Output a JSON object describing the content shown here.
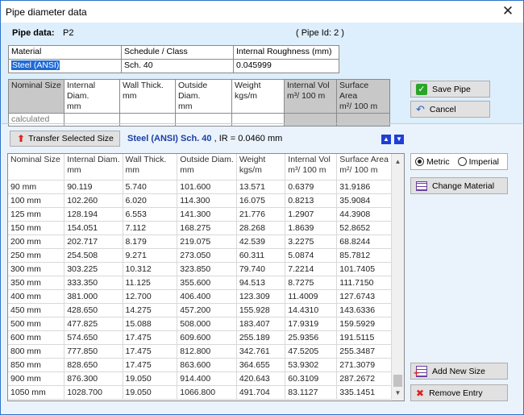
{
  "window": {
    "title": "Pipe diameter data",
    "close_icon": "close-icon"
  },
  "pipe_data": {
    "label": "Pipe data:",
    "value": "P2",
    "pipe_id": "( Pipe Id: 2 )"
  },
  "material_table": {
    "headers": [
      "Material",
      "Schedule / Class",
      "Internal Roughness (mm)"
    ],
    "values": [
      "Steel (ANSI)",
      "Sch.  40",
      "0.045999"
    ]
  },
  "size_table": {
    "headers": [
      [
        "Nominal Size",
        ""
      ],
      [
        "Internal Diam.",
        "mm"
      ],
      [
        "Wall Thick.",
        "mm"
      ],
      [
        "Outside Diam.",
        "mm"
      ],
      [
        "Weight",
        "kgs/m"
      ],
      [
        "Internal Vol",
        "m³/ 100 m"
      ],
      [
        "Surface Area",
        "m²/ 100 m"
      ]
    ],
    "row": [
      "calculated",
      "",
      "",
      "",
      "",
      "",
      ""
    ]
  },
  "buttons": {
    "save": "Save Pipe",
    "cancel": "Cancel",
    "transfer": "Transfer Selected Size",
    "change_material": "Change Material",
    "add_size": "Add New Size",
    "remove": "Remove Entry"
  },
  "transfer_info": {
    "material": "Steel (ANSI) Sch.  40",
    "ir": ", IR = 0.0460 mm"
  },
  "units": {
    "metric": "Metric",
    "imperial": "Imperial",
    "selected": "metric"
  },
  "list": {
    "headers": [
      [
        "Nominal Size",
        ""
      ],
      [
        "Internal Diam.",
        "mm"
      ],
      [
        "Wall Thick.",
        "mm"
      ],
      [
        "Outside Diam.",
        "mm"
      ],
      [
        "Weight",
        "kgs/m"
      ],
      [
        "Internal Vol",
        "m³/ 100 m"
      ],
      [
        "Surface Area",
        "m²/ 100 m"
      ]
    ],
    "rows": [
      [
        "90 mm",
        "90.119",
        "5.740",
        "101.600",
        "13.571",
        "0.6379",
        "31.9186"
      ],
      [
        "100 mm",
        "102.260",
        "6.020",
        "114.300",
        "16.075",
        "0.8213",
        "35.9084"
      ],
      [
        "125 mm",
        "128.194",
        "6.553",
        "141.300",
        "21.776",
        "1.2907",
        "44.3908"
      ],
      [
        "150 mm",
        "154.051",
        "7.112",
        "168.275",
        "28.268",
        "1.8639",
        "52.8652"
      ],
      [
        "200 mm",
        "202.717",
        "8.179",
        "219.075",
        "42.539",
        "3.2275",
        "68.8244"
      ],
      [
        "250 mm",
        "254.508",
        "9.271",
        "273.050",
        "60.311",
        "5.0874",
        "85.7812"
      ],
      [
        "300 mm",
        "303.225",
        "10.312",
        "323.850",
        "79.740",
        "7.2214",
        "101.7405"
      ],
      [
        "350 mm",
        "333.350",
        "11.125",
        "355.600",
        "94.513",
        "8.7275",
        "111.7150"
      ],
      [
        "400 mm",
        "381.000",
        "12.700",
        "406.400",
        "123.309",
        "11.4009",
        "127.6743"
      ],
      [
        "450 mm",
        "428.650",
        "14.275",
        "457.200",
        "155.928",
        "14.4310",
        "143.6336"
      ],
      [
        "500 mm",
        "477.825",
        "15.088",
        "508.000",
        "183.407",
        "17.9319",
        "159.5929"
      ],
      [
        "600 mm",
        "574.650",
        "17.475",
        "609.600",
        "255.189",
        "25.9356",
        "191.5115"
      ],
      [
        "800 mm",
        "777.850",
        "17.475",
        "812.800",
        "342.761",
        "47.5205",
        "255.3487"
      ],
      [
        "850 mm",
        "828.650",
        "17.475",
        "863.600",
        "364.655",
        "53.9302",
        "271.3079"
      ],
      [
        "900 mm",
        "876.300",
        "19.050",
        "914.400",
        "420.643",
        "60.3109",
        "287.2672"
      ],
      [
        "1050 mm",
        "1028.700",
        "19.050",
        "1066.800",
        "491.704",
        "83.1127",
        "335.1451"
      ]
    ]
  }
}
